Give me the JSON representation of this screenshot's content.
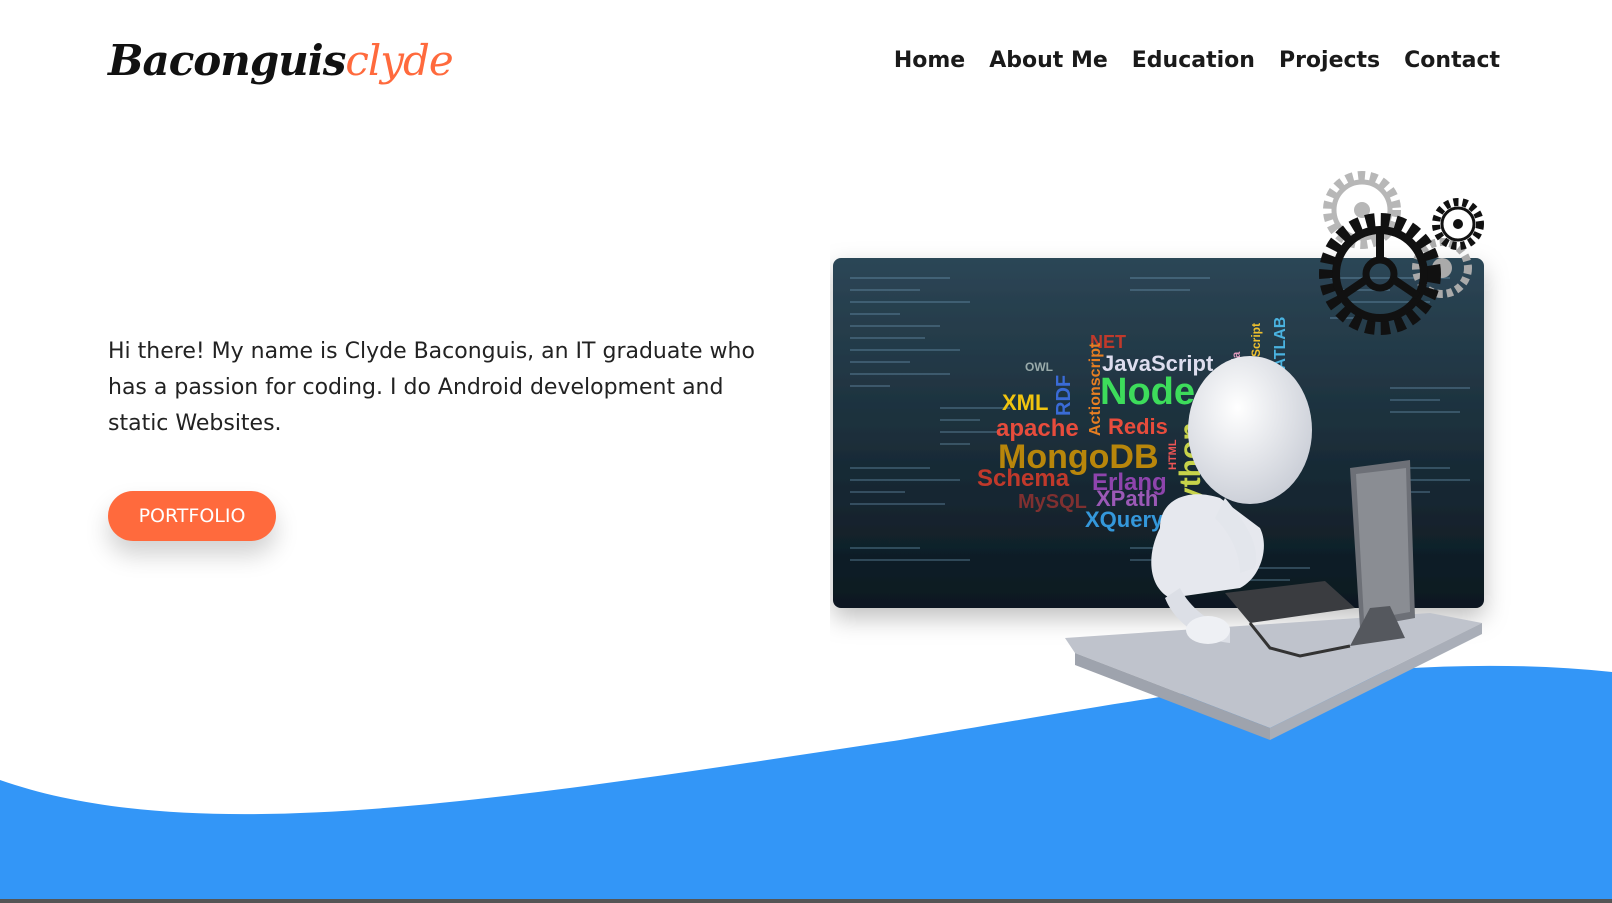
{
  "brand": {
    "name": "Baconguis",
    "accent": "clyde",
    "accent_color": "#ff6a3d"
  },
  "nav": {
    "home": "Home",
    "about": "About Me",
    "education": "Education",
    "projects": "Projects",
    "contact": "Contact"
  },
  "hero": {
    "intro": "Hi there! My name is Clyde Baconguis, an IT graduate who has a passion for coding. I do Android development and static Websites.",
    "button_label": "PORTFOLIO",
    "button_color": "#ff6a3d"
  },
  "illustration": {
    "tech_words": [
      "JavaScript",
      "Node.js",
      "XML",
      "RDF",
      "Actionscript",
      "apache",
      "Redis",
      "MongoDB",
      "Schema",
      "Erlang",
      "XPath",
      "XQuery",
      "Python",
      "OWL",
      "NET",
      "PostScript",
      "MATLAB",
      "HTML",
      "MySQL"
    ]
  },
  "colors": {
    "wave_blue": "#3396f7",
    "accent": "#ff6a3d"
  }
}
